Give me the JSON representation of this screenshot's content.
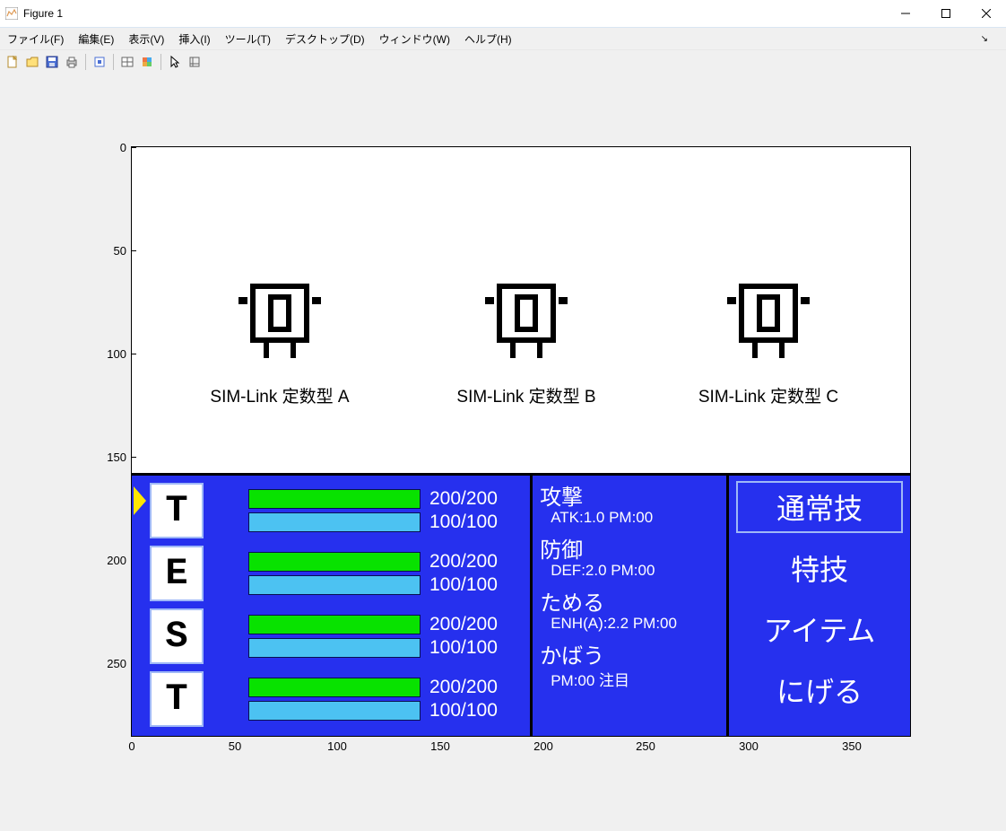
{
  "window": {
    "title": "Figure 1"
  },
  "menu": {
    "file": "ファイル(F)",
    "edit": "編集(E)",
    "view": "表示(V)",
    "insert": "挿入(I)",
    "tool": "ツール(T)",
    "desktop": "デスクトップ(D)",
    "window": "ウィンドウ(W)",
    "help": "ヘルプ(H)"
  },
  "axes": {
    "y_ticks": [
      "0",
      "50",
      "100",
      "150",
      "200",
      "250"
    ],
    "x_ticks": [
      "0",
      "50",
      "100",
      "150",
      "200",
      "250",
      "300",
      "350"
    ]
  },
  "enemies": [
    {
      "label": "SIM-Link 定数型 A"
    },
    {
      "label": "SIM-Link 定数型 B"
    },
    {
      "label": "SIM-Link 定数型 C"
    }
  ],
  "party": [
    {
      "letter": "T",
      "hp": "200/200",
      "mp": "100/100"
    },
    {
      "letter": "E",
      "hp": "200/200",
      "mp": "100/100"
    },
    {
      "letter": "S",
      "hp": "200/200",
      "mp": "100/100"
    },
    {
      "letter": "T",
      "hp": "200/200",
      "mp": "100/100"
    }
  ],
  "skills": [
    {
      "name": "攻撃",
      "info": "ATK:1.0 PM:00"
    },
    {
      "name": "防御",
      "info": "DEF:2.0 PM:00"
    },
    {
      "name": "ためる",
      "info": "ENH(A):2.2 PM:00"
    },
    {
      "name": "かばう",
      "info": "PM:00 注目"
    }
  ],
  "commands": {
    "normal": "通常技",
    "special": "特技",
    "item": "アイテム",
    "flee": "にげる"
  }
}
